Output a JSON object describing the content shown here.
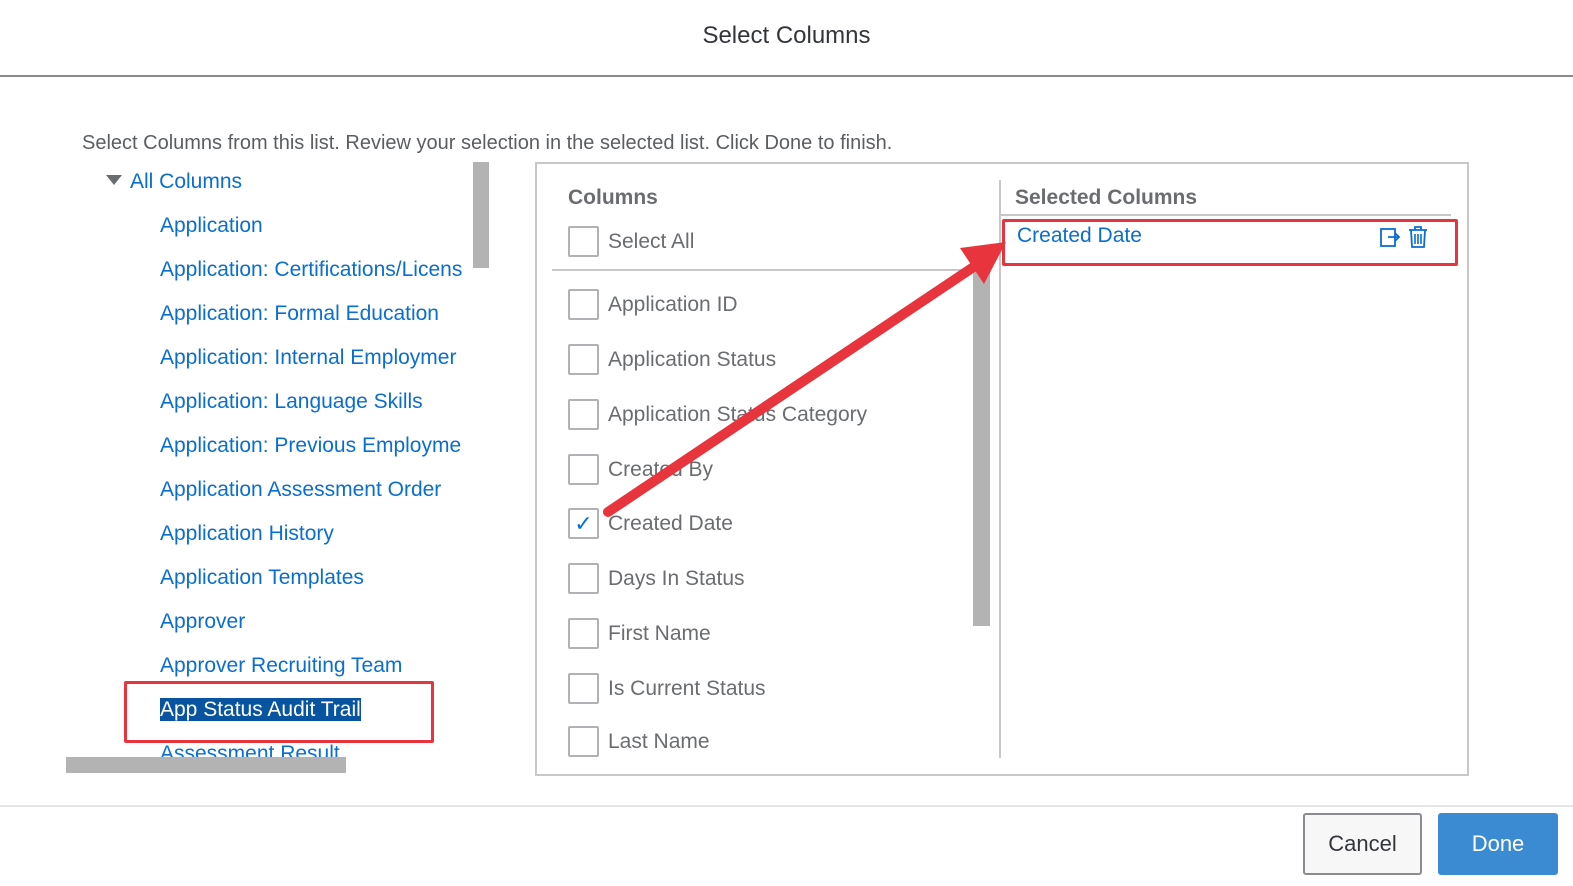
{
  "dialog": {
    "title": "Select Columns"
  },
  "instructions": "Select Columns from this list. Review your selection in the selected list. Click Done to finish.",
  "tree": {
    "root_label": "All Columns",
    "items": [
      {
        "label": "Application"
      },
      {
        "label": "Application: Certifications/Licens"
      },
      {
        "label": "Application: Formal Education"
      },
      {
        "label": "Application: Internal Employmer"
      },
      {
        "label": "Application: Language Skills"
      },
      {
        "label": "Application: Previous Employme"
      },
      {
        "label": "Application Assessment Order"
      },
      {
        "label": "Application History"
      },
      {
        "label": "Application Templates"
      },
      {
        "label": "Approver"
      },
      {
        "label": "Approver Recruiting Team"
      },
      {
        "label": "App Status Audit Trail",
        "selected": true
      },
      {
        "label": "Assessment Result"
      }
    ]
  },
  "columns": {
    "header": "Columns",
    "select_all_label": "Select All",
    "items": [
      {
        "label": "Application ID",
        "checked": false
      },
      {
        "label": "Application Status",
        "checked": false
      },
      {
        "label": "Application Status Category",
        "checked": false
      },
      {
        "label": "Created By",
        "checked": false
      },
      {
        "label": "Created Date",
        "checked": true
      },
      {
        "label": "Days In Status",
        "checked": false
      },
      {
        "label": "First Name",
        "checked": false
      },
      {
        "label": "Is Current Status",
        "checked": false
      },
      {
        "label": "Last Name",
        "checked": false
      }
    ]
  },
  "selected": {
    "header": "Selected Columns",
    "items": [
      {
        "label": "Created Date"
      }
    ],
    "icons": [
      "export-icon",
      "trash-icon"
    ]
  },
  "footer": {
    "cancel_label": "Cancel",
    "done_label": "Done"
  },
  "colors": {
    "link": "#0a6ed1",
    "highlight": "#e8343c",
    "primary_button": "#3a8bd1",
    "selection_bg": "#0854a0"
  }
}
